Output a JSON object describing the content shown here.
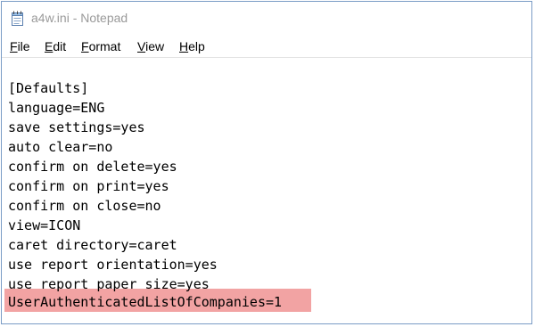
{
  "window": {
    "title": "a4w.ini - Notepad",
    "app_icon": "notepad-icon"
  },
  "menubar": {
    "items": [
      {
        "label": "File",
        "accel": "F",
        "rest": "ile"
      },
      {
        "label": "Edit",
        "accel": "E",
        "rest": "dit"
      },
      {
        "label": "Format",
        "accel": "F",
        "rest": "ormat"
      },
      {
        "label": "View",
        "accel": "V",
        "rest": "iew"
      },
      {
        "label": "Help",
        "accel": "H",
        "rest": "elp"
      }
    ]
  },
  "editor": {
    "lines": [
      "[Defaults]",
      "language=ENG",
      "save settings=yes",
      "auto clear=no",
      "confirm on delete=yes",
      "confirm on print=yes",
      "confirm on close=no",
      "view=ICON",
      "caret directory=caret",
      "use report orientation=yes",
      "use report paper size=yes",
      "UserAuthenticatedListOfCompanies=1"
    ],
    "highlighted_line_index": 11,
    "highlight_color": "#f2a3a3"
  }
}
